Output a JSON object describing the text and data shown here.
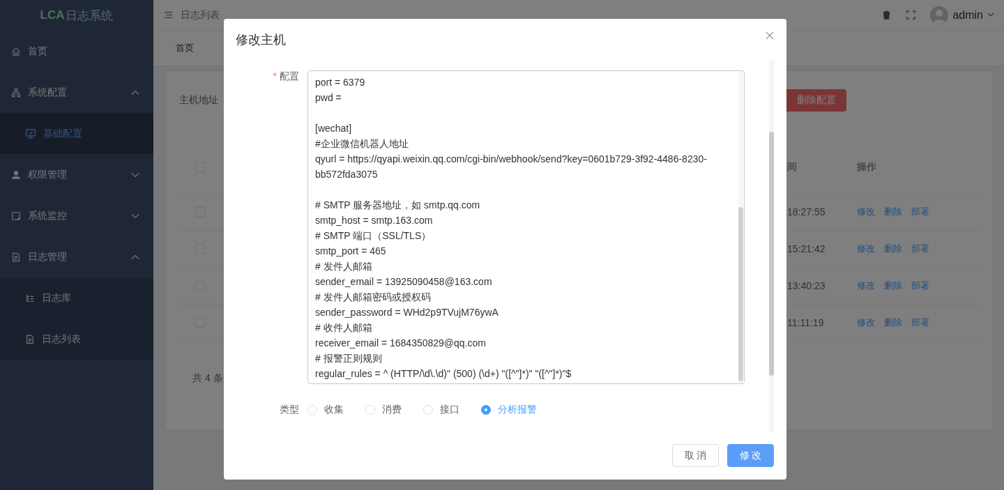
{
  "sidebar": {
    "logo": "LCA",
    "title": "日志系统",
    "items": [
      {
        "label": "首页",
        "selected": false
      },
      {
        "label": "系统配置",
        "selected": false,
        "expanded": true,
        "children": [
          {
            "label": "基础配置",
            "selected": true
          }
        ]
      },
      {
        "label": "权限管理",
        "selected": false,
        "expanded": false
      },
      {
        "label": "系统监控",
        "selected": false,
        "expanded": false
      },
      {
        "label": "日志管理",
        "selected": false,
        "expanded": true,
        "children": [
          {
            "label": "日志库",
            "selected": false
          },
          {
            "label": "日志列表",
            "selected": false
          }
        ]
      }
    ]
  },
  "header": {
    "breadcrumb": "日志列表",
    "user": "admin"
  },
  "tabs": [
    {
      "label": "首页",
      "selected": false
    }
  ],
  "filter": {
    "label": "主机地址",
    "delete_button": "删除配置"
  },
  "table": {
    "header_checked": false,
    "columns": [
      "间",
      "操作"
    ],
    "rows": [
      {
        "checked": false,
        "time": "18:27:55",
        "actions": [
          "修改",
          "删除",
          "部署"
        ]
      },
      {
        "checked": false,
        "time": "15:21:42",
        "actions": [
          "修改",
          "删除",
          "部署"
        ]
      },
      {
        "checked": false,
        "time": "13:40:23",
        "actions": [
          "修改",
          "删除",
          "部署"
        ]
      },
      {
        "checked": false,
        "time": "11:11:19",
        "actions": [
          "修改",
          "删除",
          "部署"
        ]
      }
    ]
  },
  "pagination": {
    "total": "共 4 条"
  },
  "modal": {
    "title": "修改主机",
    "config": {
      "label": "配置",
      "required_mark": "*",
      "value": "port = 6379\npwd = \n\n[wechat]\n#企业微信机器人地址\nqyurl = https://qyapi.weixin.qq.com/cgi-bin/webhook/send?key=0601b729-3f92-4486-8230-bb572fda3075\n\n# SMTP 服务器地址，如 smtp.qq.com\nsmtp_host = smtp.163.com\n# SMTP 端口（SSL/TLS）\nsmtp_port = 465\n# 发件人邮箱\nsender_email = 13925090458@163.com\n# 发件人邮箱密码或授权码\nsender_password = WHd2p9TVujM76ywA\n# 收件人邮箱\nreceiver_email = 1684350829@qq.com\n# 报警正则规则\nregular_rules = ^ (HTTP/\\d\\.\\d)\" (500) (\\d+) \"([^\"]*)\" \"([^\"]*)\"$"
    },
    "type": {
      "label": "类型",
      "options": [
        {
          "label": "收集",
          "selected": false
        },
        {
          "label": "消费",
          "selected": false
        },
        {
          "label": "接口",
          "selected": false
        },
        {
          "label": "分析报警",
          "selected": true
        }
      ]
    },
    "buttons": {
      "cancel": "取 消",
      "confirm": "修 改"
    }
  }
}
